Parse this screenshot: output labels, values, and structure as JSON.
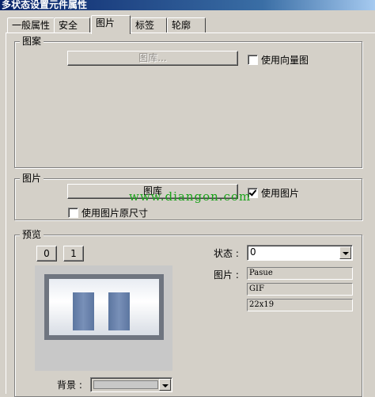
{
  "window": {
    "title": "多状态设置元件属性"
  },
  "tabs": [
    {
      "label": "一般属性"
    },
    {
      "label": "安全"
    },
    {
      "label": "图片"
    },
    {
      "label": "标签"
    },
    {
      "label": "轮廓"
    }
  ],
  "pattern_group": {
    "legend": "图案",
    "library_button": "图库...",
    "vector_checkbox": {
      "label": "使用向量图",
      "checked": false
    }
  },
  "picture_group": {
    "legend": "图片",
    "library_button": "图库",
    "use_picture_checkbox": {
      "label": "使用图片",
      "checked": true
    },
    "original_size_checkbox": {
      "label": "使用图片原尺寸",
      "checked": false
    }
  },
  "preview_group": {
    "legend": "预览",
    "state_buttons": [
      "0",
      "1"
    ],
    "state_label": "状态 :",
    "state_value": "0",
    "picture_label": "图片 :",
    "picture_name": "Pasue",
    "picture_format": "GIF",
    "picture_size": "22x19",
    "background_label": "背景 :"
  },
  "watermark": "www.diangon.com",
  "colors": {
    "titlebar": "#0a246a",
    "face": "#d4d0c8",
    "preview_bar": "#6b84ad"
  }
}
